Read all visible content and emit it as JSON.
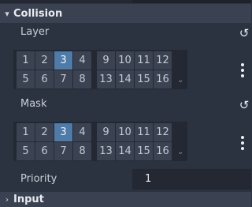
{
  "section": {
    "title": "Collision",
    "arrow": "▾"
  },
  "layer": {
    "label": "Layer",
    "revert_glyph": "↺",
    "bits": [
      "1",
      "2",
      "3",
      "4",
      "9",
      "10",
      "11",
      "12",
      "5",
      "6",
      "7",
      "8",
      "13",
      "14",
      "15",
      "16"
    ],
    "active": [
      "3"
    ],
    "expand_glyph": "⌄"
  },
  "mask": {
    "label": "Mask",
    "revert_glyph": "↺",
    "bits": [
      "1",
      "2",
      "3",
      "4",
      "9",
      "10",
      "11",
      "12",
      "5",
      "6",
      "7",
      "8",
      "13",
      "14",
      "15",
      "16"
    ],
    "active": [
      "3"
    ],
    "expand_glyph": "⌄"
  },
  "priority": {
    "label": "Priority",
    "value": "1"
  },
  "next_section": {
    "title": "Input",
    "arrow": "›"
  },
  "colors": {
    "active_bit": "#4f7ba8",
    "bit": "#3b4352",
    "panel": "#232833",
    "header": "#3a4150",
    "background": "#2c3340"
  }
}
